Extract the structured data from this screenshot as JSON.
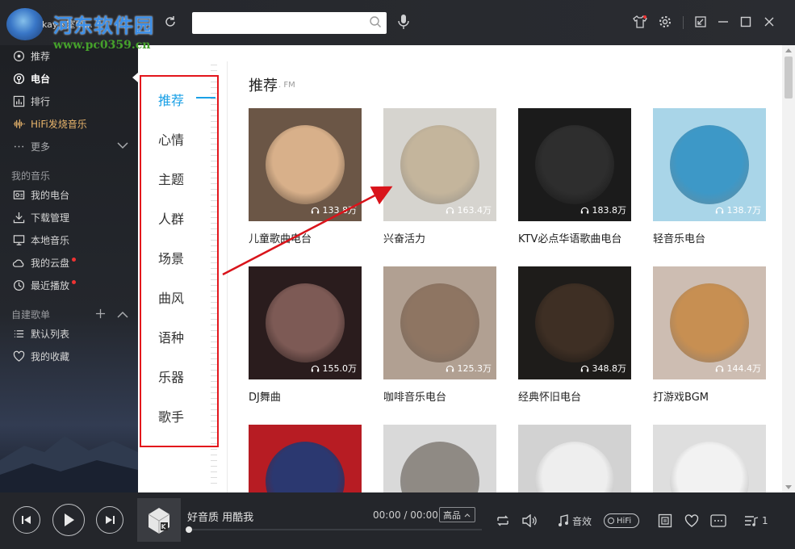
{
  "topbar": {
    "watermark_title": "河东软件园",
    "watermark_url": "www.pc0359.cn",
    "user_name": "kay丶室中...",
    "search": {
      "value": "",
      "placeholder": ""
    }
  },
  "sidebar": {
    "items": [
      {
        "label": "推荐",
        "icon": "recommend-icon"
      },
      {
        "label": "电台",
        "icon": "radio-icon",
        "active": true
      },
      {
        "label": "排行",
        "icon": "chart-icon"
      },
      {
        "label": "HiFi发烧音乐",
        "icon": "waveform-icon"
      },
      {
        "label": "更多",
        "icon": "dots-icon"
      }
    ],
    "section_my_music": "我的音乐",
    "my_items": [
      {
        "label": "我的电台",
        "icon": "my-radio-icon"
      },
      {
        "label": "下载管理",
        "icon": "download-icon"
      },
      {
        "label": "本地音乐",
        "icon": "monitor-icon"
      },
      {
        "label": "我的云盘",
        "icon": "cloud-icon"
      },
      {
        "label": "最近播放",
        "icon": "clock-icon"
      }
    ],
    "section_playlists": "自建歌单",
    "playlist_items": [
      {
        "label": "默认列表",
        "icon": "list-icon"
      },
      {
        "label": "我的收藏",
        "icon": "heart-icon"
      }
    ]
  },
  "categories": [
    "推荐",
    "心情",
    "主题",
    "人群",
    "场景",
    "曲风",
    "语种",
    "乐器",
    "歌手"
  ],
  "main": {
    "title": "推荐",
    "subtitle": ". FM",
    "stations": [
      {
        "title": "儿童歌曲电台",
        "plays": "133.8万",
        "bg": "#6b5646",
        "circ": "#d8b08a"
      },
      {
        "title": "兴奋活力",
        "plays": "163.4万",
        "bg": "#d6d4cf",
        "circ": "#c4b59c"
      },
      {
        "title": "KTV必点华语歌曲电台",
        "plays": "183.8万",
        "bg": "#1b1b1b",
        "circ": "#2e2e2e"
      },
      {
        "title": "轻音乐电台",
        "plays": "138.7万",
        "bg": "#a9d5e8",
        "circ": "#3d98c7"
      },
      {
        "title": "DJ舞曲",
        "plays": "155.0万",
        "bg": "#2a1c1d",
        "circ": "#7d5a55"
      },
      {
        "title": "咖啡音乐电台",
        "plays": "125.3万",
        "bg": "#b1a092",
        "circ": "#8e7562"
      },
      {
        "title": "经典怀旧电台",
        "plays": "348.8万",
        "bg": "#1e1c1a",
        "circ": "#3e2f24"
      },
      {
        "title": "打游戏BGM",
        "plays": "144.4万",
        "bg": "#cdbdb2",
        "circ": "#c78f52"
      },
      {
        "title": "",
        "plays": "",
        "bg": "#b71c23",
        "circ": "#2b3870"
      },
      {
        "title": "",
        "plays": "",
        "bg": "#d9d9d9",
        "circ": "#8f8a84"
      },
      {
        "title": "",
        "plays": "",
        "bg": "#d2d2d2",
        "circ": "#eeeeee"
      },
      {
        "title": "",
        "plays": "",
        "bg": "#dedede",
        "circ": "#f2f2f2"
      }
    ]
  },
  "player": {
    "song_title": "好音质 用酷我",
    "time": "00:00 / 00:00",
    "quality": "高品",
    "effect_label": "音效",
    "hifi_label": "HiFi",
    "queue_count": "1",
    "progress": 0
  }
}
